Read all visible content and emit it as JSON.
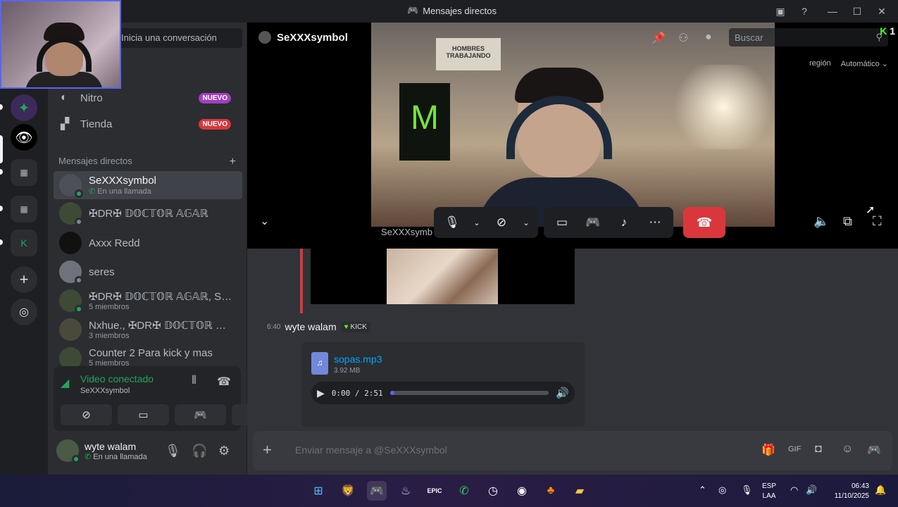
{
  "window": {
    "title": "Mensajes directos"
  },
  "sidebar": {
    "search_placeholder": "Inicia una conversación",
    "nitro": {
      "label": "Nitro",
      "badge": "NUEVO"
    },
    "shop": {
      "label": "Tienda",
      "badge": "NUEVO"
    },
    "dm_header": "Mensajes directos",
    "dms": [
      {
        "name": "SeXXXsymbol",
        "sub": "En una llamada",
        "status": "online",
        "active": true
      },
      {
        "name": "✠DR✠ 𝔻𝕆ℂ𝕋𝕆ℝ 𝔸𝔾𝔸ℝ",
        "sub": "",
        "status": "offline",
        "active": false
      },
      {
        "name": "Axxx Redd",
        "sub": "",
        "status": "none",
        "active": false
      },
      {
        "name": "seres",
        "sub": "",
        "status": "offline",
        "active": false
      },
      {
        "name": "✠DR✠ 𝔻𝕆ℂ𝕋𝕆ℝ 𝔸𝔾𝔸ℝ, SeX...",
        "sub": "5 miembros",
        "status": "online",
        "active": false
      },
      {
        "name": "Nxhue., ✠DR✠ 𝔻𝕆ℂ𝕋𝕆ℝ 𝔸𝔾...",
        "sub": "3 miembros",
        "status": "none",
        "active": false
      },
      {
        "name": "Counter 2 Para kick y mas",
        "sub": "5 miembros",
        "status": "none",
        "active": false
      }
    ],
    "voice": {
      "title": "Video conectado",
      "channel": "SeXXXsymbol"
    },
    "user": {
      "name": "wyte walam",
      "status": "En una llamada"
    }
  },
  "call": {
    "name": "SeXXXsymbol",
    "search_placeholder": "Buscar",
    "kick_count": "1",
    "region_label": "región",
    "region_value": "Automático",
    "caller_label": "SeXXXsymb",
    "wall_sign": "HOMBRES TRABAJANDO"
  },
  "chat": {
    "message": {
      "time": "6:40",
      "author": "wyte walam",
      "tag": "KICK",
      "file": {
        "name": "sopas.mp3",
        "size": "3.92 MB"
      },
      "player": {
        "time": "0:00 / 2:51",
        "progress": 0.03
      }
    },
    "composer_placeholder": "Enviar mensaje a @SeXXXsymbol"
  },
  "taskbar": {
    "lang": "ESP",
    "lang2": "LAA",
    "time": "06:43",
    "date": "11/10/2025"
  },
  "colors": {
    "accent": "#5865f2",
    "online": "#23a55a",
    "danger": "#da373c",
    "kick": "#53fc18"
  }
}
